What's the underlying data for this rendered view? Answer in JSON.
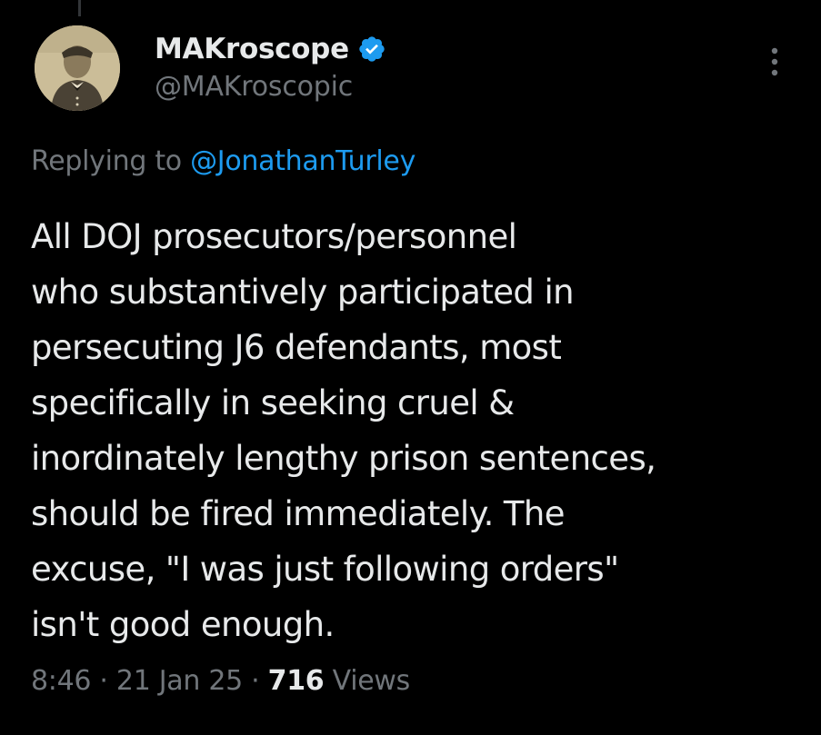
{
  "author": {
    "display_name": "MAKroscope",
    "handle": "@MAKroscopic",
    "verified_icon": "verified-badge-icon"
  },
  "reply": {
    "prefix": "Replying to",
    "mention": "@JonathanTurley"
  },
  "tweet": {
    "lines": [
      "All DOJ prosecutors/personnel",
      "who substantively participated in",
      "persecuting J6 defendants, most",
      "specifically in seeking cruel &",
      "inordinately lengthy prison sentences,",
      "should be fired immediately. The",
      "excuse, \"I was just following orders\"",
      "isn't good enough."
    ]
  },
  "meta": {
    "time": "8:46",
    "separator": "·",
    "date": "21 Jan 25",
    "views_count": "716",
    "views_label": "Views"
  },
  "colors": {
    "background": "#000000",
    "text": "#e7e9ea",
    "secondary": "#71767b",
    "link": "#1d9bf0",
    "verified": "#1d9bf0"
  }
}
